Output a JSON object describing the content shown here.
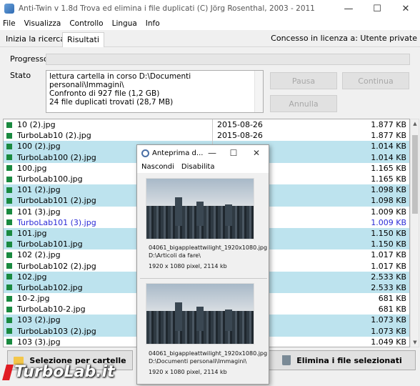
{
  "window": {
    "title": "Anti-Twin   v 1.8d    Trova ed elimina i file duplicati    (C) Jörg Rosenthal, 2003 - 2011",
    "min_glyph": "—",
    "max_glyph": "☐",
    "close_glyph": "✕"
  },
  "menu": [
    "File",
    "Visualizza",
    "Controllo",
    "Lingua",
    "Info"
  ],
  "tabs": {
    "ricerca": "Inizia la ricerca",
    "risultati": "Risultati",
    "license": "Concesso in licenza a: Utente private"
  },
  "progress": {
    "label": "Progresso",
    "fraction": 0
  },
  "status": {
    "label": "Stato",
    "lines": [
      "lettura cartella in corso D:\\Documenti personali\\Immagini\\",
      "Confronto di 927 file (1,2 GB)",
      "24 file duplicati trovati (28,7 MB)"
    ]
  },
  "buttons": {
    "pausa": "Pausa",
    "continua": "Continua",
    "annulla": "Annulla",
    "selezione": "Selezione per cartelle",
    "elimina": "Elimina i file selezionati"
  },
  "results": [
    {
      "name": "10 (2).jpg",
      "date": "2015-08-26",
      "size": "1.877 KB",
      "blue": false,
      "link": false
    },
    {
      "name": "TurboLab10 (2).jpg",
      "date": "2015-08-26",
      "size": "1.877 KB",
      "blue": false,
      "link": false
    },
    {
      "name": "100 (2).jpg",
      "date": "",
      "size": "1.014 KB",
      "blue": true,
      "link": false
    },
    {
      "name": "TurboLab100 (2).jpg",
      "date": "",
      "size": "1.014 KB",
      "blue": true,
      "link": false
    },
    {
      "name": "100.jpg",
      "date": "",
      "size": "1.165 KB",
      "blue": false,
      "link": false
    },
    {
      "name": "TurboLab100.jpg",
      "date": "",
      "size": "1.165 KB",
      "blue": false,
      "link": false
    },
    {
      "name": "101 (2).jpg",
      "date": "",
      "size": "1.098 KB",
      "blue": true,
      "link": false
    },
    {
      "name": "TurboLab101 (2).jpg",
      "date": "",
      "size": "1.098 KB",
      "blue": true,
      "link": false
    },
    {
      "name": "101 (3).jpg",
      "date": "",
      "size": "1.009 KB",
      "blue": false,
      "link": false
    },
    {
      "name": "TurboLab101 (3).jpg",
      "date": "",
      "size": "1.009 KB",
      "blue": false,
      "link": true
    },
    {
      "name": "101.jpg",
      "date": "",
      "size": "1.150 KB",
      "blue": true,
      "link": false
    },
    {
      "name": "TurboLab101.jpg",
      "date": "",
      "size": "1.150 KB",
      "blue": true,
      "link": false
    },
    {
      "name": "102 (2).jpg",
      "date": "",
      "size": "1.017 KB",
      "blue": false,
      "link": false
    },
    {
      "name": "TurboLab102 (2).jpg",
      "date": "",
      "size": "1.017 KB",
      "blue": false,
      "link": false
    },
    {
      "name": "102.jpg",
      "date": "",
      "size": "2.533 KB",
      "blue": true,
      "link": false
    },
    {
      "name": "TurboLab102.jpg",
      "date": "",
      "size": "2.533 KB",
      "blue": true,
      "link": false
    },
    {
      "name": "10-2.jpg",
      "date": "",
      "size": "681 KB",
      "blue": false,
      "link": false
    },
    {
      "name": "TurboLab10-2.jpg",
      "date": "",
      "size": "681 KB",
      "blue": false,
      "link": false
    },
    {
      "name": "103 (2).jpg",
      "date": "",
      "size": "1.073 KB",
      "blue": true,
      "link": false
    },
    {
      "name": "TurboLab103 (2).jpg",
      "date": "",
      "size": "1.073 KB",
      "blue": true,
      "link": false
    },
    {
      "name": "103 (3).jpg",
      "date": "",
      "size": "1.049 KB",
      "blue": false,
      "link": false
    }
  ],
  "preview": {
    "title": "Anteprima d...",
    "menu": [
      "Nascondi",
      "Disabilita"
    ],
    "items": [
      {
        "filename": "04061_bigappleattwilight_1920x1080.jpg",
        "path": "D:\\Articoli da fare\\",
        "info": "1920 x 1080 pixel, 2114 kb"
      },
      {
        "filename": "04061_bigappleattwilight_1920x1080.jpg",
        "path": "D:\\Documenti personali\\Immagini\\",
        "info": "1920 x 1080 pixel, 2114 kb"
      }
    ]
  },
  "watermark": "TurboLab.it",
  "colors": {
    "row_highlight": "#bde3ee",
    "check_green": "#1a8a40",
    "link_blue": "#2b2bd6",
    "watermark_red": "#e01b22"
  },
  "icons": {
    "app": "anti-twin-icon",
    "preview": "magnifier-icon",
    "selezione": "folder-icon",
    "elimina": "trash-icon"
  }
}
